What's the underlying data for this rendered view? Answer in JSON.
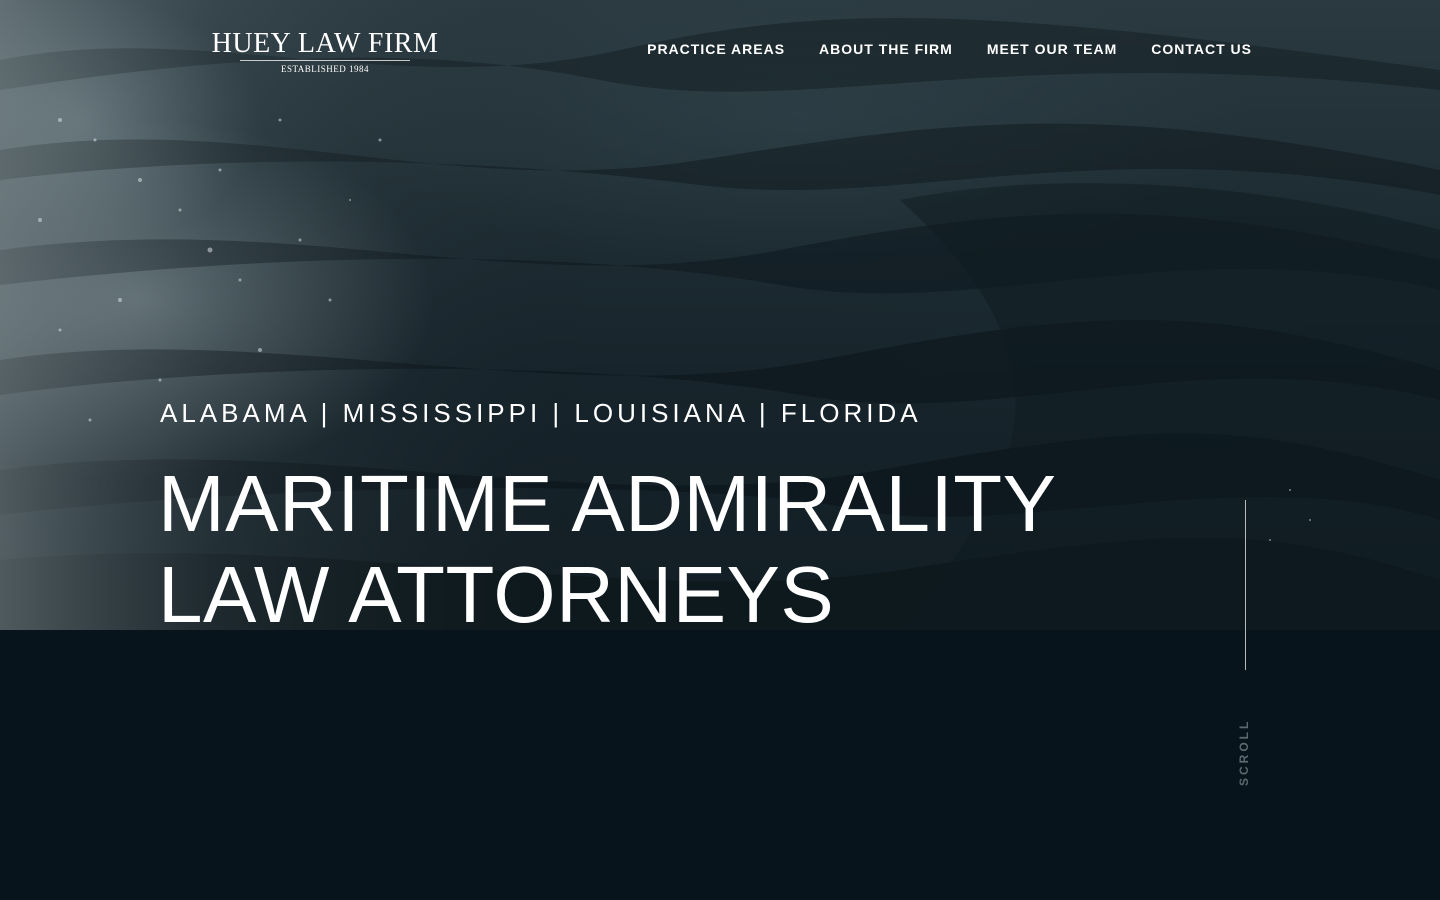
{
  "header": {
    "logo": {
      "title": "HUEY LAW FIRM",
      "subtitle": "ESTABLISHED 1984"
    },
    "nav": [
      {
        "label": "PRACTICE AREAS"
      },
      {
        "label": "ABOUT THE FIRM"
      },
      {
        "label": "MEET OUR TEAM"
      },
      {
        "label": "CONTACT US"
      }
    ]
  },
  "hero": {
    "states": "ALABAMA | MISSISSIPPI | LOUISIANA | FLORIDA",
    "headline_line1": "MARITIME ADMIRALITY",
    "headline_line2": "LAW ATTORNEYS",
    "background": "ocean-water-image"
  },
  "scroll": {
    "label": "SCROLL"
  },
  "colors": {
    "page_background": "#07141b",
    "text": "#ffffff",
    "scroll_label": "#5c6a70"
  }
}
